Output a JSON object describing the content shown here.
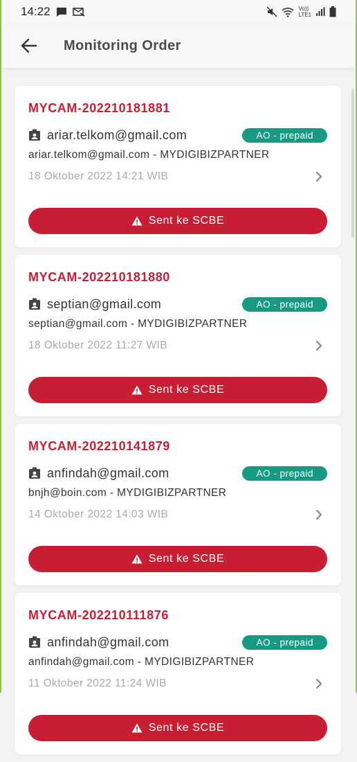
{
  "status_bar": {
    "time": "14:22",
    "network_label_top": "Vo))",
    "network_label_bottom": "LTE1"
  },
  "header": {
    "title": "Monitoring Order"
  },
  "orders": [
    {
      "id": "MYCAM-202210181881",
      "email": "ariar.telkom@gmail.com",
      "tag": "AO - prepaid",
      "subtitle": "ariar.telkom@gmail.com - MYDIGIBIZPARTNER",
      "date": "18 Oktober 2022 14:21 WIB",
      "action": "Sent ke SCBE"
    },
    {
      "id": "MYCAM-202210181880",
      "email": "septian@gmail.com",
      "tag": "AO - prepaid",
      "subtitle": "septian@gmail.com - MYDIGIBIZPARTNER",
      "date": "18 Oktober 2022 11:27 WIB",
      "action": "Sent ke SCBE"
    },
    {
      "id": "MYCAM-202210141879",
      "email": "anfindah@gmail.com",
      "tag": "AO - prepaid",
      "subtitle": "bnjh@boin.com - MYDIGIBIZPARTNER",
      "date": "14 Oktober 2022 14:03 WIB",
      "action": "Sent ke SCBE"
    },
    {
      "id": "MYCAM-202210111876",
      "email": "anfindah@gmail.com",
      "tag": "AO - prepaid",
      "subtitle": "anfindah@gmail.com - MYDIGIBIZPARTNER",
      "date": "11 Oktober 2022 11:24 WIB",
      "action": "Sent ke SCBE"
    }
  ],
  "colors": {
    "accent_red": "#c81e34",
    "tag_green": "#169b82",
    "frame_green": "#8cc63f"
  }
}
